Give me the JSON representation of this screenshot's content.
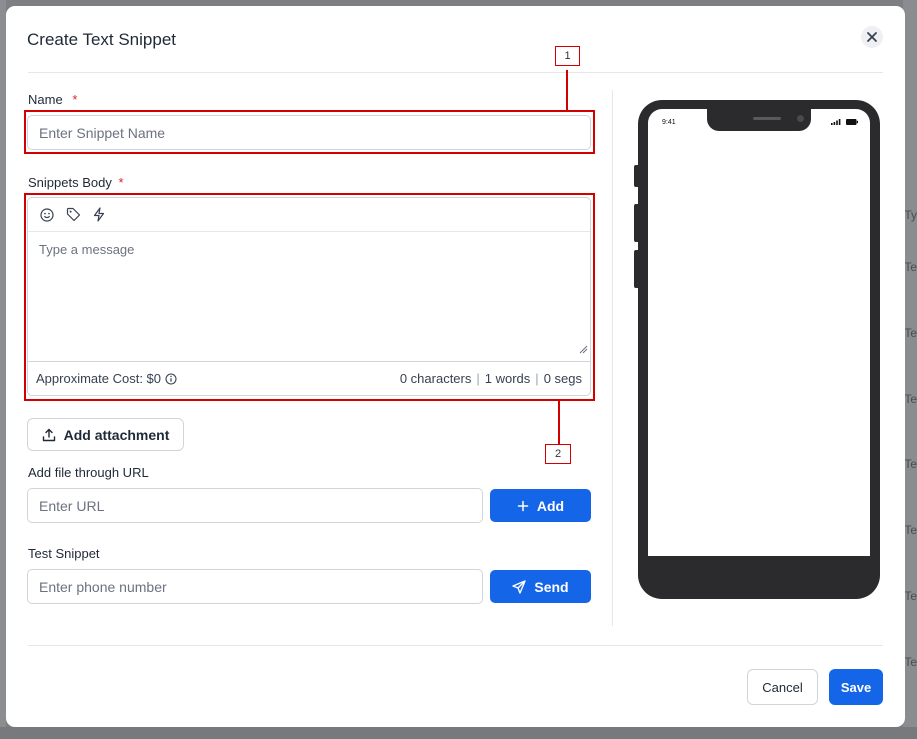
{
  "modal": {
    "title": "Create Text Snippet"
  },
  "form": {
    "name_label": "Name",
    "name_required": "*",
    "name_placeholder": "Enter Snippet Name",
    "body_label": "Snippets Body",
    "body_required": "*",
    "body_placeholder": "Type a message",
    "toolbar_icons": [
      "emoji-icon",
      "tag-icon",
      "lightning-icon"
    ],
    "approx_cost": "Approximate Cost: $0",
    "characters": "0 characters",
    "words": "1 words",
    "segs": "0 segs",
    "add_attachment_label": "Add attachment",
    "file_url_label": "Add file through URL",
    "url_placeholder": "Enter URL",
    "add_button_label": "Add",
    "test_label": "Test Snippet",
    "phone_placeholder": "Enter phone number",
    "send_button_label": "Send"
  },
  "footer": {
    "cancel_label": "Cancel",
    "save_label": "Save"
  },
  "preview": {
    "time": "9:41"
  },
  "annotations": {
    "tag_1": "1",
    "tag_2": "2"
  },
  "background": {
    "row_labels": [
      "Ty",
      "Te",
      "Te",
      "Te",
      "Te",
      "Te",
      "Te",
      "Te"
    ]
  },
  "colors": {
    "primary": "#1565e8",
    "required": "#dc2626",
    "annotation": "#d40000"
  }
}
